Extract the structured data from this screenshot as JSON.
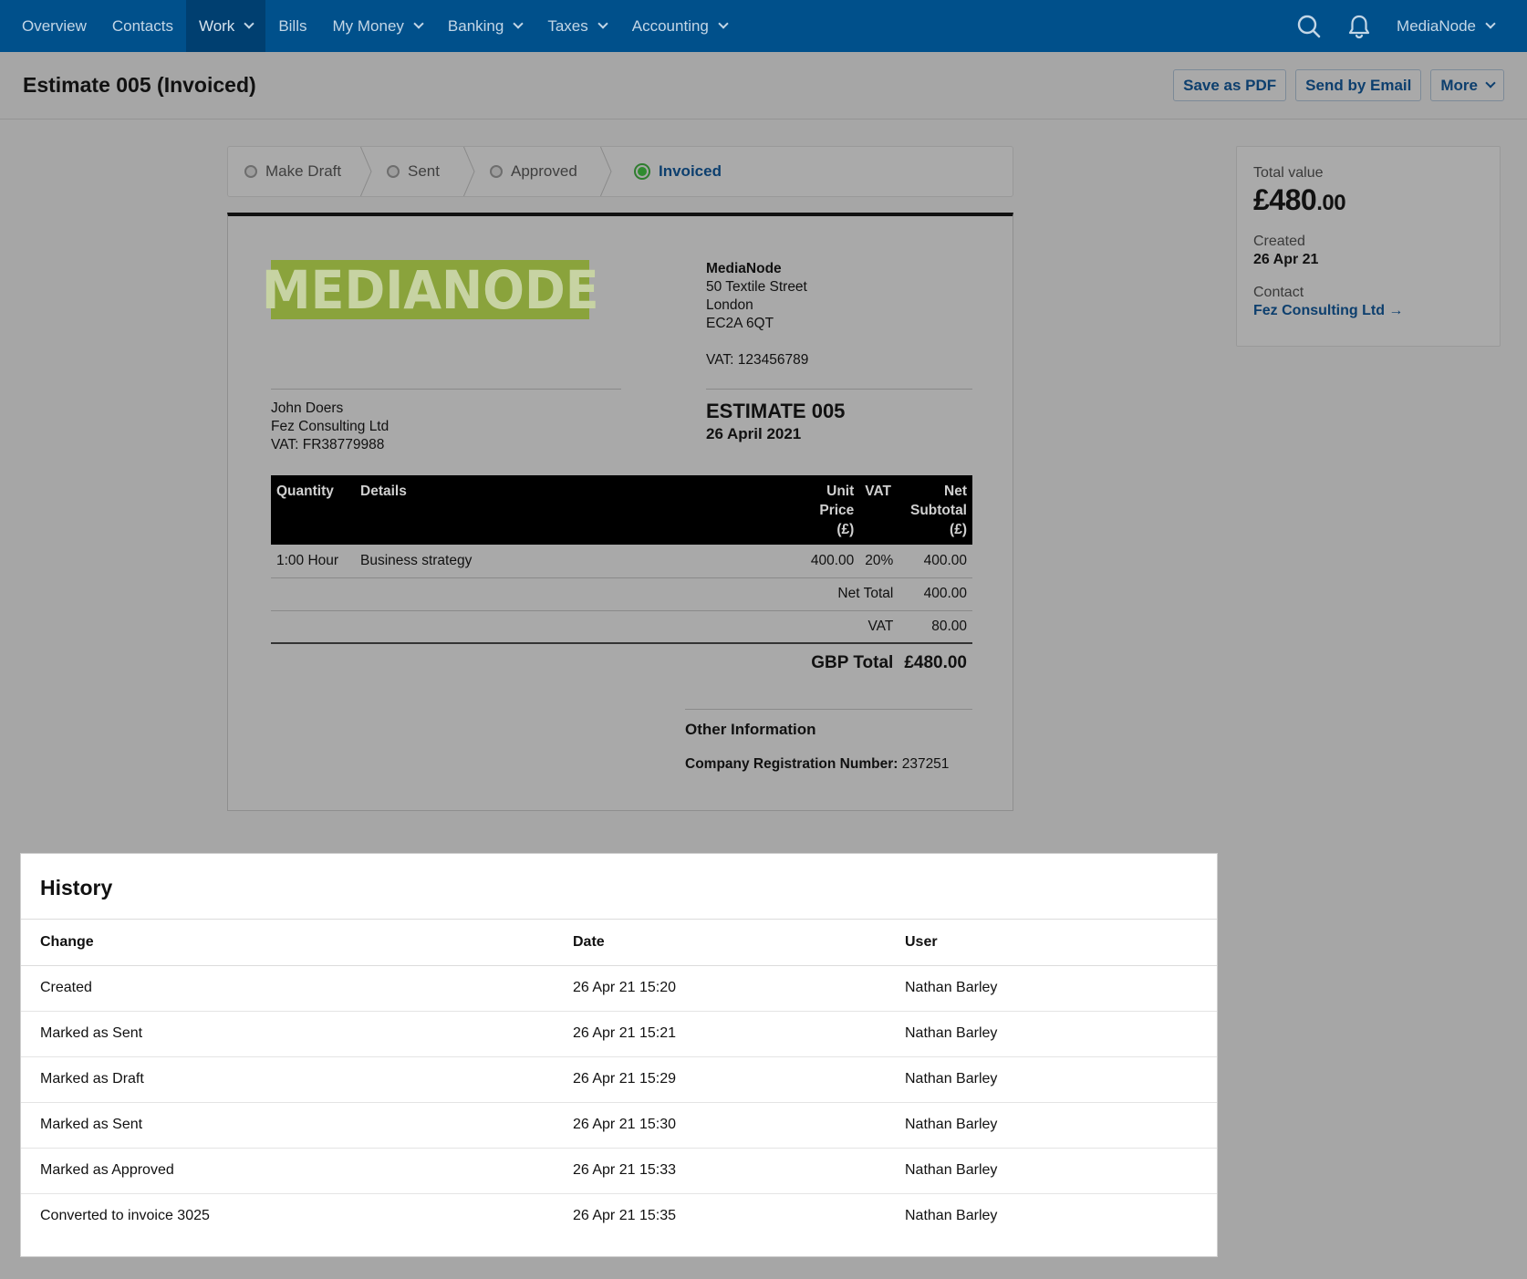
{
  "nav": {
    "items": [
      {
        "label": "Overview",
        "dropdown": false,
        "active": false
      },
      {
        "label": "Contacts",
        "dropdown": false,
        "active": false
      },
      {
        "label": "Work",
        "dropdown": true,
        "active": true
      },
      {
        "label": "Bills",
        "dropdown": false,
        "active": false
      },
      {
        "label": "My Money",
        "dropdown": true,
        "active": false
      },
      {
        "label": "Banking",
        "dropdown": true,
        "active": false
      },
      {
        "label": "Taxes",
        "dropdown": true,
        "active": false
      },
      {
        "label": "Accounting",
        "dropdown": true,
        "active": false
      }
    ],
    "account": "MediaNode",
    "icons": [
      "search-icon",
      "bell-icon"
    ]
  },
  "header": {
    "title": "Estimate 005 (Invoiced)",
    "actions": {
      "save_pdf": "Save as PDF",
      "send_email": "Send by Email",
      "more": "More"
    }
  },
  "stepper": {
    "steps": [
      {
        "label": "Make Draft",
        "state": "done"
      },
      {
        "label": "Sent",
        "state": "done"
      },
      {
        "label": "Approved",
        "state": "done"
      },
      {
        "label": "Invoiced",
        "state": "current"
      }
    ]
  },
  "summary": {
    "total_label": "Total value",
    "total_main": "£480",
    "total_pence": ".00",
    "created_label": "Created",
    "created_value": "26 Apr 21",
    "contact_label": "Contact",
    "contact_value": "Fez Consulting Ltd →"
  },
  "document": {
    "logo_text": "MEDIANODE",
    "from": {
      "name": "MediaNode",
      "street": "50 Textile Street",
      "city": "London",
      "postcode": "EC2A 6QT",
      "vat": "VAT: 123456789"
    },
    "to": {
      "name": "John Doers",
      "company": "Fez Consulting Ltd",
      "vat": "VAT: FR38779988"
    },
    "estimate_title": "ESTIMATE 005",
    "estimate_date": "26 April 2021",
    "columns": {
      "quantity": "Quantity",
      "details": "Details",
      "unit_price": [
        "Unit",
        "Price",
        "(£)"
      ],
      "vat": "VAT",
      "net_subtotal": [
        "Net",
        "Subtotal",
        "(£)"
      ]
    },
    "lines": [
      {
        "quantity": "1:00 Hour",
        "details": "Business strategy",
        "unit_price": "400.00",
        "vat": "20%",
        "net": "400.00"
      }
    ],
    "net_total_label": "Net Total",
    "net_total_value": "400.00",
    "vat_label": "VAT",
    "vat_value": "80.00",
    "gbp_total_label": "GBP Total",
    "gbp_total_value": "£480.00",
    "other_heading": "Other Information",
    "reg_label": "Company Registration Number:",
    "reg_value": "237251"
  },
  "history": {
    "title": "History",
    "columns": {
      "change": "Change",
      "date": "Date",
      "user": "User"
    },
    "rows": [
      {
        "change": "Created",
        "date": "26 Apr 21 15:20",
        "user": "Nathan Barley"
      },
      {
        "change": "Marked as Sent",
        "date": "26 Apr 21 15:21",
        "user": "Nathan Barley"
      },
      {
        "change": "Marked as Draft",
        "date": "26 Apr 21 15:29",
        "user": "Nathan Barley"
      },
      {
        "change": "Marked as Sent",
        "date": "26 Apr 21 15:30",
        "user": "Nathan Barley"
      },
      {
        "change": "Marked as Approved",
        "date": "26 Apr 21 15:33",
        "user": "Nathan Barley"
      },
      {
        "change": "Converted to invoice 3025",
        "date": "26 Apr 21 15:35",
        "user": "Nathan Barley"
      }
    ]
  },
  "colors": {
    "nav_bg": "#00508b",
    "accent": "#0d3f6e",
    "logo_green": "#8aa33c",
    "success": "#2f8b2f"
  }
}
